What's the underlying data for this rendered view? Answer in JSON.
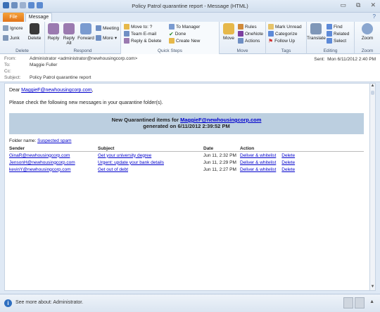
{
  "window": {
    "title": "Policy Patrol quarantine report - Message (HTML)",
    "minimize": "▭",
    "restore": "⧉",
    "close": "✕"
  },
  "tabs": {
    "file": "File",
    "message": "Message",
    "help": "?"
  },
  "ribbon": {
    "delete_group": {
      "label": "Delete",
      "ignore": "Ignore",
      "junk": "Junk",
      "delete": "Delete"
    },
    "respond_group": {
      "label": "Respond",
      "reply": "Reply",
      "reply_all": "Reply All",
      "forward": "Forward",
      "meeting": "Meeting",
      "more": "More"
    },
    "quicksteps_group": {
      "label": "Quick Steps",
      "move_to": "Move to: ?",
      "team_email": "Team E-mail",
      "reply_delete": "Reply & Delete",
      "to_manager": "To Manager",
      "done": "Done",
      "create_new": "Create New"
    },
    "move_group": {
      "label": "Move",
      "move": "Move",
      "rules": "Rules",
      "onenote": "OneNote",
      "actions": "Actions"
    },
    "tags_group": {
      "label": "Tags",
      "mark_unread": "Mark Unread",
      "categorize": "Categorize",
      "follow_up": "Follow Up"
    },
    "editing_group": {
      "label": "Editing",
      "translate": "Translate",
      "find": "Find",
      "related": "Related",
      "select": "Select"
    },
    "zoom_group": {
      "label": "Zoom",
      "zoom": "Zoom"
    }
  },
  "header": {
    "from_label": "From:",
    "from": "Administrator <administrator@newhousingcorp.com>",
    "to_label": "To:",
    "to": "Maggie Fuller",
    "cc_label": "Cc:",
    "cc": "",
    "subject_label": "Subject:",
    "subject": "Policy Patrol quarantine report",
    "sent_label": "Sent:",
    "sent": "Mon 6/11/2012 2:40 PM"
  },
  "message": {
    "greeting_prefix": "Dear ",
    "greeting_email": "MaggieF@newhousingcorp.com",
    "greeting_suffix": ",",
    "intro": "Please check the following new messages in your quarantine folder(s).",
    "banner_line1_prefix": "New Quarantined items for ",
    "banner_email": "MaggieF@newhousingcorp.com",
    "banner_line2": "generated on 6/11/2012 2:39:52 PM",
    "folder_label": "Folder name: ",
    "folder_name": "Suspected spam",
    "columns": {
      "sender": "Sender",
      "subject": "Subject",
      "date": "Date",
      "action": "Action"
    },
    "rows": [
      {
        "sender": "GinaR@newhousingcorp.com",
        "subject": "Get your university degree",
        "date": "Jun 11, 2:32 PM",
        "action1": "Deliver & whitelist",
        "action2": "Delete"
      },
      {
        "sender": "JensonH@newhousingcorp.com",
        "subject": "Urgent: update your bank details",
        "date": "Jun 11, 2:29 PM",
        "action1": "Deliver & whitelist",
        "action2": "Delete"
      },
      {
        "sender": "kevinY@newhousingcorp.com",
        "subject": "Get out of debt",
        "date": "Jun 11, 2:27 PM",
        "action1": "Deliver & whitelist",
        "action2": "Delete"
      }
    ]
  },
  "status": {
    "text": "See more about: Administrator."
  }
}
